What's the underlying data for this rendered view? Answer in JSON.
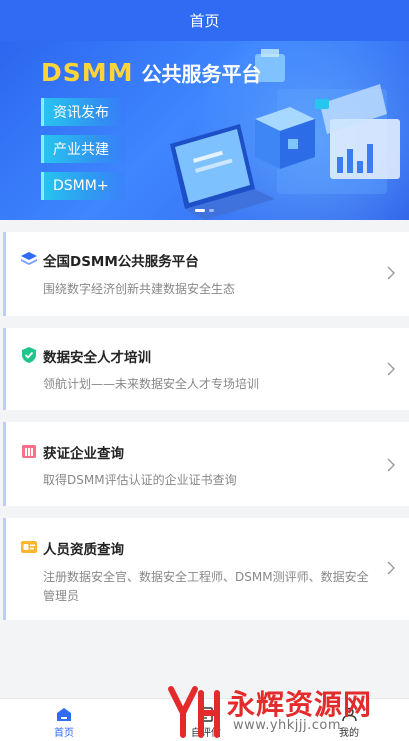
{
  "header": {
    "title": "首页"
  },
  "banner": {
    "brand_highlight": "DSMM",
    "brand_text": "公共服务平台",
    "pills": [
      "资讯发布",
      "产业共建",
      "DSMM+"
    ]
  },
  "cards": [
    {
      "title": "全国DSMM公共服务平台",
      "subtitle": "围绕数字经济创新共建数据安全生态",
      "icon": "stack-layers-icon"
    },
    {
      "title": "数据安全人才培训",
      "subtitle": "领航计划——未来数据安全人才专场培训",
      "icon": "shield-check-icon"
    },
    {
      "title": "获证企业查询",
      "subtitle": "取得DSMM评估认证的企业证书查询",
      "icon": "building-icon"
    },
    {
      "title": "人员资质查询",
      "subtitle": "注册数据安全官、数据安全工程师、DSMM测评师、数据安全管理员",
      "icon": "id-card-icon"
    }
  ],
  "tabbar": {
    "tabs": [
      {
        "label": "首页",
        "icon": "home-icon",
        "active": true
      },
      {
        "label": "自评估",
        "icon": "clipboard-icon",
        "active": false
      },
      {
        "label": "我的",
        "icon": "user-icon",
        "active": false
      }
    ]
  },
  "watermark": {
    "text": "永辉资源网",
    "url": "www.yhkjjj.com"
  },
  "colors": {
    "primary": "#2f6cf3",
    "brand_yellow": "#ffd33a",
    "watermark_red": "#e32b2b"
  }
}
